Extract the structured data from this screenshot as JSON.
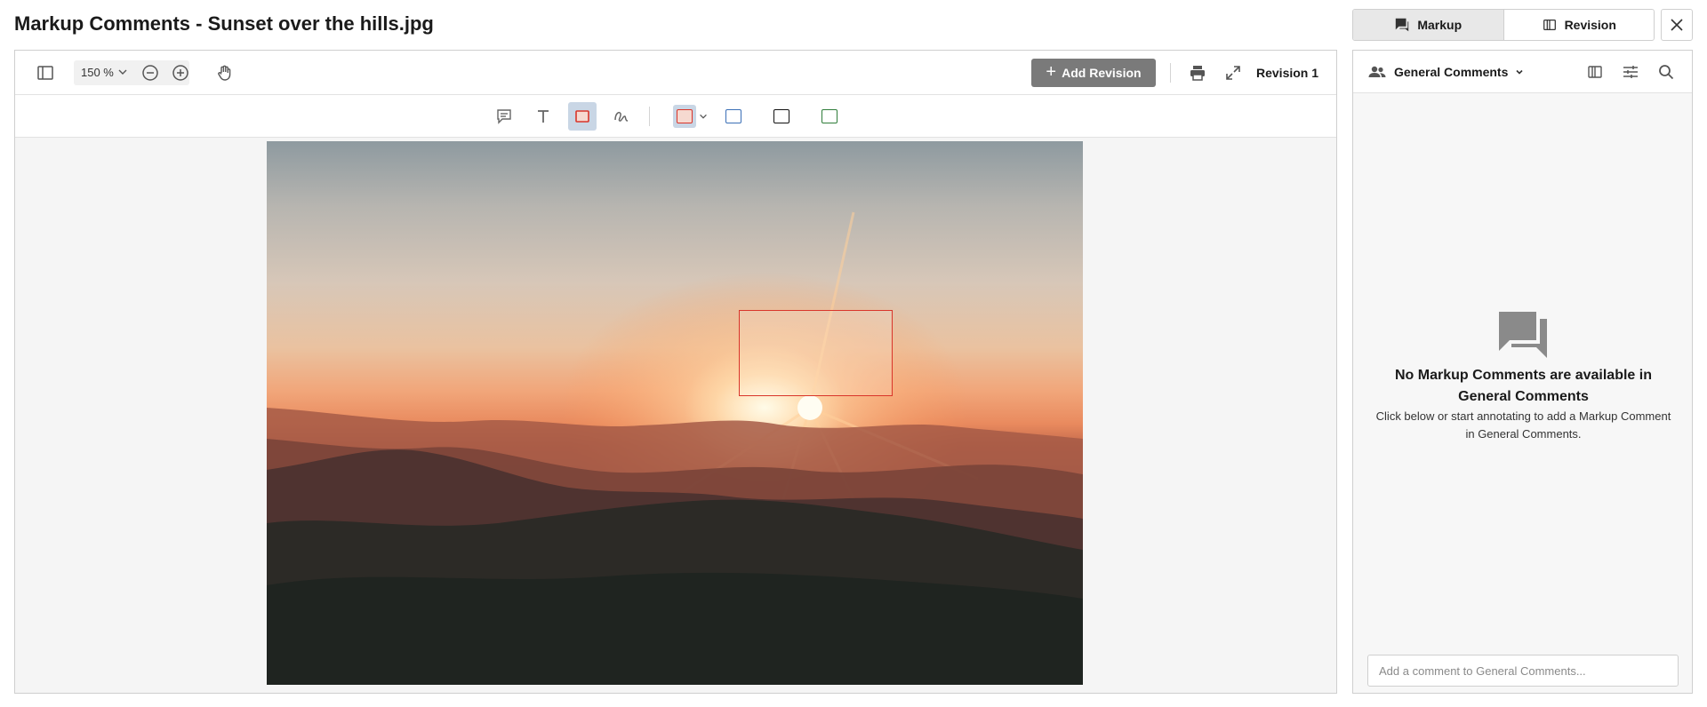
{
  "window": {
    "title": "Markup Comments - Sunset over the hills.jpg"
  },
  "toolbar": {
    "zoom_value": "150 %",
    "add_revision_label": "Add Revision",
    "add_revision_plus": "+",
    "revision_label": "Revision 1"
  },
  "annotation_colors": {
    "active_shape": "#d9352a",
    "swatch_red": "#d9352a",
    "swatch_blue": "#3b6fb6",
    "swatch_black": "#111111",
    "swatch_green": "#2f7d3a"
  },
  "view_toggle": {
    "markup_label": "Markup",
    "revision_label": "Revision",
    "active": "Markup"
  },
  "panel": {
    "group_label": "General Comments",
    "empty_title": "No Markup Comments are available in General Comments",
    "empty_subtitle": "Click below or start annotating to add a Markup Comment in General Comments.",
    "comment_placeholder": "Add a comment to General Comments..."
  },
  "icons": {
    "sidebar_toggle": "sidebar-panel-icon",
    "zoom_out": "minus-circle-icon",
    "zoom_in": "plus-circle-icon",
    "pan": "hand-icon",
    "print": "printer-icon",
    "fullscreen": "expand-icon",
    "comment_tool": "comment-icon",
    "text_tool": "text-icon",
    "rect_tool": "rectangle-icon",
    "draw_tool": "freehand-icon",
    "markup": "chat-icon",
    "revision": "compare-icon",
    "close": "close-icon",
    "people": "people-icon",
    "compare_panel": "compare-icon",
    "filter": "sliders-icon",
    "search": "search-icon",
    "empty_state": "chat-bubbles-icon"
  }
}
